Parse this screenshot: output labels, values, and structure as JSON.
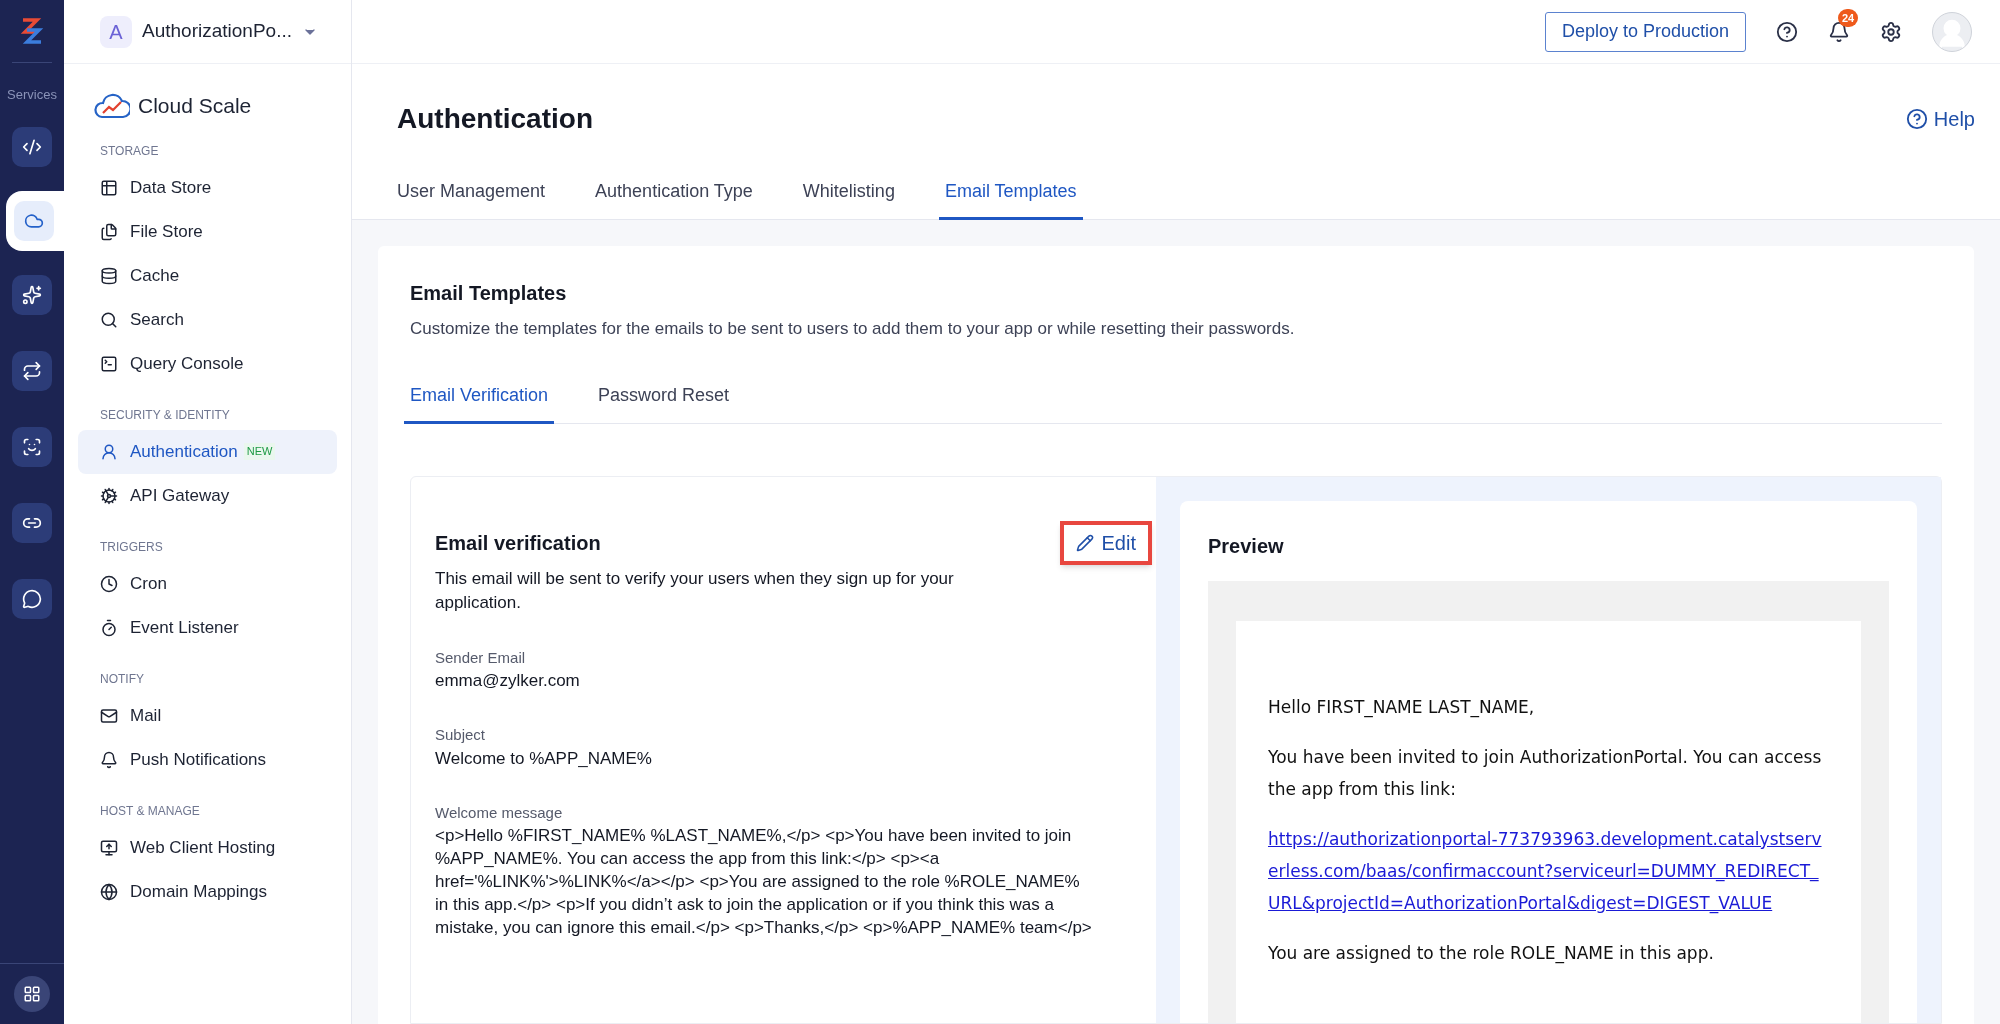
{
  "rail": {
    "label": "Services",
    "items": [
      {
        "selected": false
      },
      {
        "selected": true
      },
      {
        "selected": false
      },
      {
        "selected": false
      },
      {
        "selected": false
      },
      {
        "selected": false
      },
      {
        "selected": false
      }
    ]
  },
  "project": {
    "initial": "A",
    "name": "AuthorizationPo..."
  },
  "topbar": {
    "deploy_button": "Deploy to Production",
    "notification_count": "24"
  },
  "sidebar": {
    "title": "Cloud Scale",
    "sections": [
      {
        "heading": "STORAGE",
        "items": [
          {
            "label": "Data Store",
            "selected": false
          },
          {
            "label": "File Store",
            "selected": false
          },
          {
            "label": "Cache",
            "selected": false
          },
          {
            "label": "Search",
            "selected": false
          },
          {
            "label": "Query Console",
            "selected": false
          }
        ]
      },
      {
        "heading": "SECURITY & IDENTITY",
        "items": [
          {
            "label": "Authentication",
            "selected": true,
            "badge": "NEW"
          },
          {
            "label": "API Gateway",
            "selected": false
          }
        ]
      },
      {
        "heading": "TRIGGERS",
        "items": [
          {
            "label": "Cron",
            "selected": false
          },
          {
            "label": "Event Listener",
            "selected": false
          }
        ]
      },
      {
        "heading": "NOTIFY",
        "items": [
          {
            "label": "Mail",
            "selected": false
          },
          {
            "label": "Push Notifications",
            "selected": false
          }
        ]
      },
      {
        "heading": "HOST & MANAGE",
        "items": [
          {
            "label": "Web Client Hosting",
            "selected": false
          },
          {
            "label": "Domain Mappings",
            "selected": false
          }
        ]
      }
    ]
  },
  "page": {
    "title": "Authentication",
    "help": "Help",
    "tabs": [
      {
        "label": "User Management",
        "selected": false
      },
      {
        "label": "Authentication Type",
        "selected": false
      },
      {
        "label": "Whitelisting",
        "selected": false
      },
      {
        "label": "Email Templates",
        "selected": true
      }
    ]
  },
  "card": {
    "title": "Email Templates",
    "description": "Customize the templates for the emails to be sent to users to add them to your app or while resetting their passwords.",
    "tabs": [
      {
        "label": "Email Verification",
        "selected": true
      },
      {
        "label": "Password Reset",
        "selected": false
      }
    ],
    "template": {
      "title": "Email verification",
      "edit_button": "Edit",
      "description": "This email will be sent to verify your users when they sign up for your application.",
      "fields": [
        {
          "label": "Sender Email",
          "value": "emma@zylker.com"
        },
        {
          "label": "Subject",
          "value": "Welcome to %APP_NAME%"
        },
        {
          "label": "Welcome message",
          "value": "<p>Hello %FIRST_NAME% %LAST_NAME%,</p> <p>You have been invited to join %APP_NAME%. You can access the app from this link:</p> <p><a href='%LINK%'>%LINK%</a></p> <p>You are assigned to the role %ROLE_NAME% in this app.</p> <p>If you didn’t ask to join the application or if you think this was a mistake, you can ignore this email.</p> <p>Thanks,</p> <p>%APP_NAME% team</p>"
        }
      ]
    },
    "preview": {
      "title": "Preview",
      "paragraphs": [
        {
          "kind": "text",
          "text": "Hello FIRST_NAME LAST_NAME,"
        },
        {
          "kind": "text",
          "text": "You have been invited to join AuthorizationPortal. You can access the app from this link:"
        },
        {
          "kind": "link",
          "text": "https://authorizationportal-773793963.development.catalystserverless.com/baas/confirmaccount?serviceurl=DUMMY_REDIRECT_URL&projectId=AuthorizationPortal&digest=DIGEST_VALUE"
        },
        {
          "kind": "text",
          "text": "You are assigned to the role ROLE_NAME in this app."
        }
      ]
    }
  }
}
